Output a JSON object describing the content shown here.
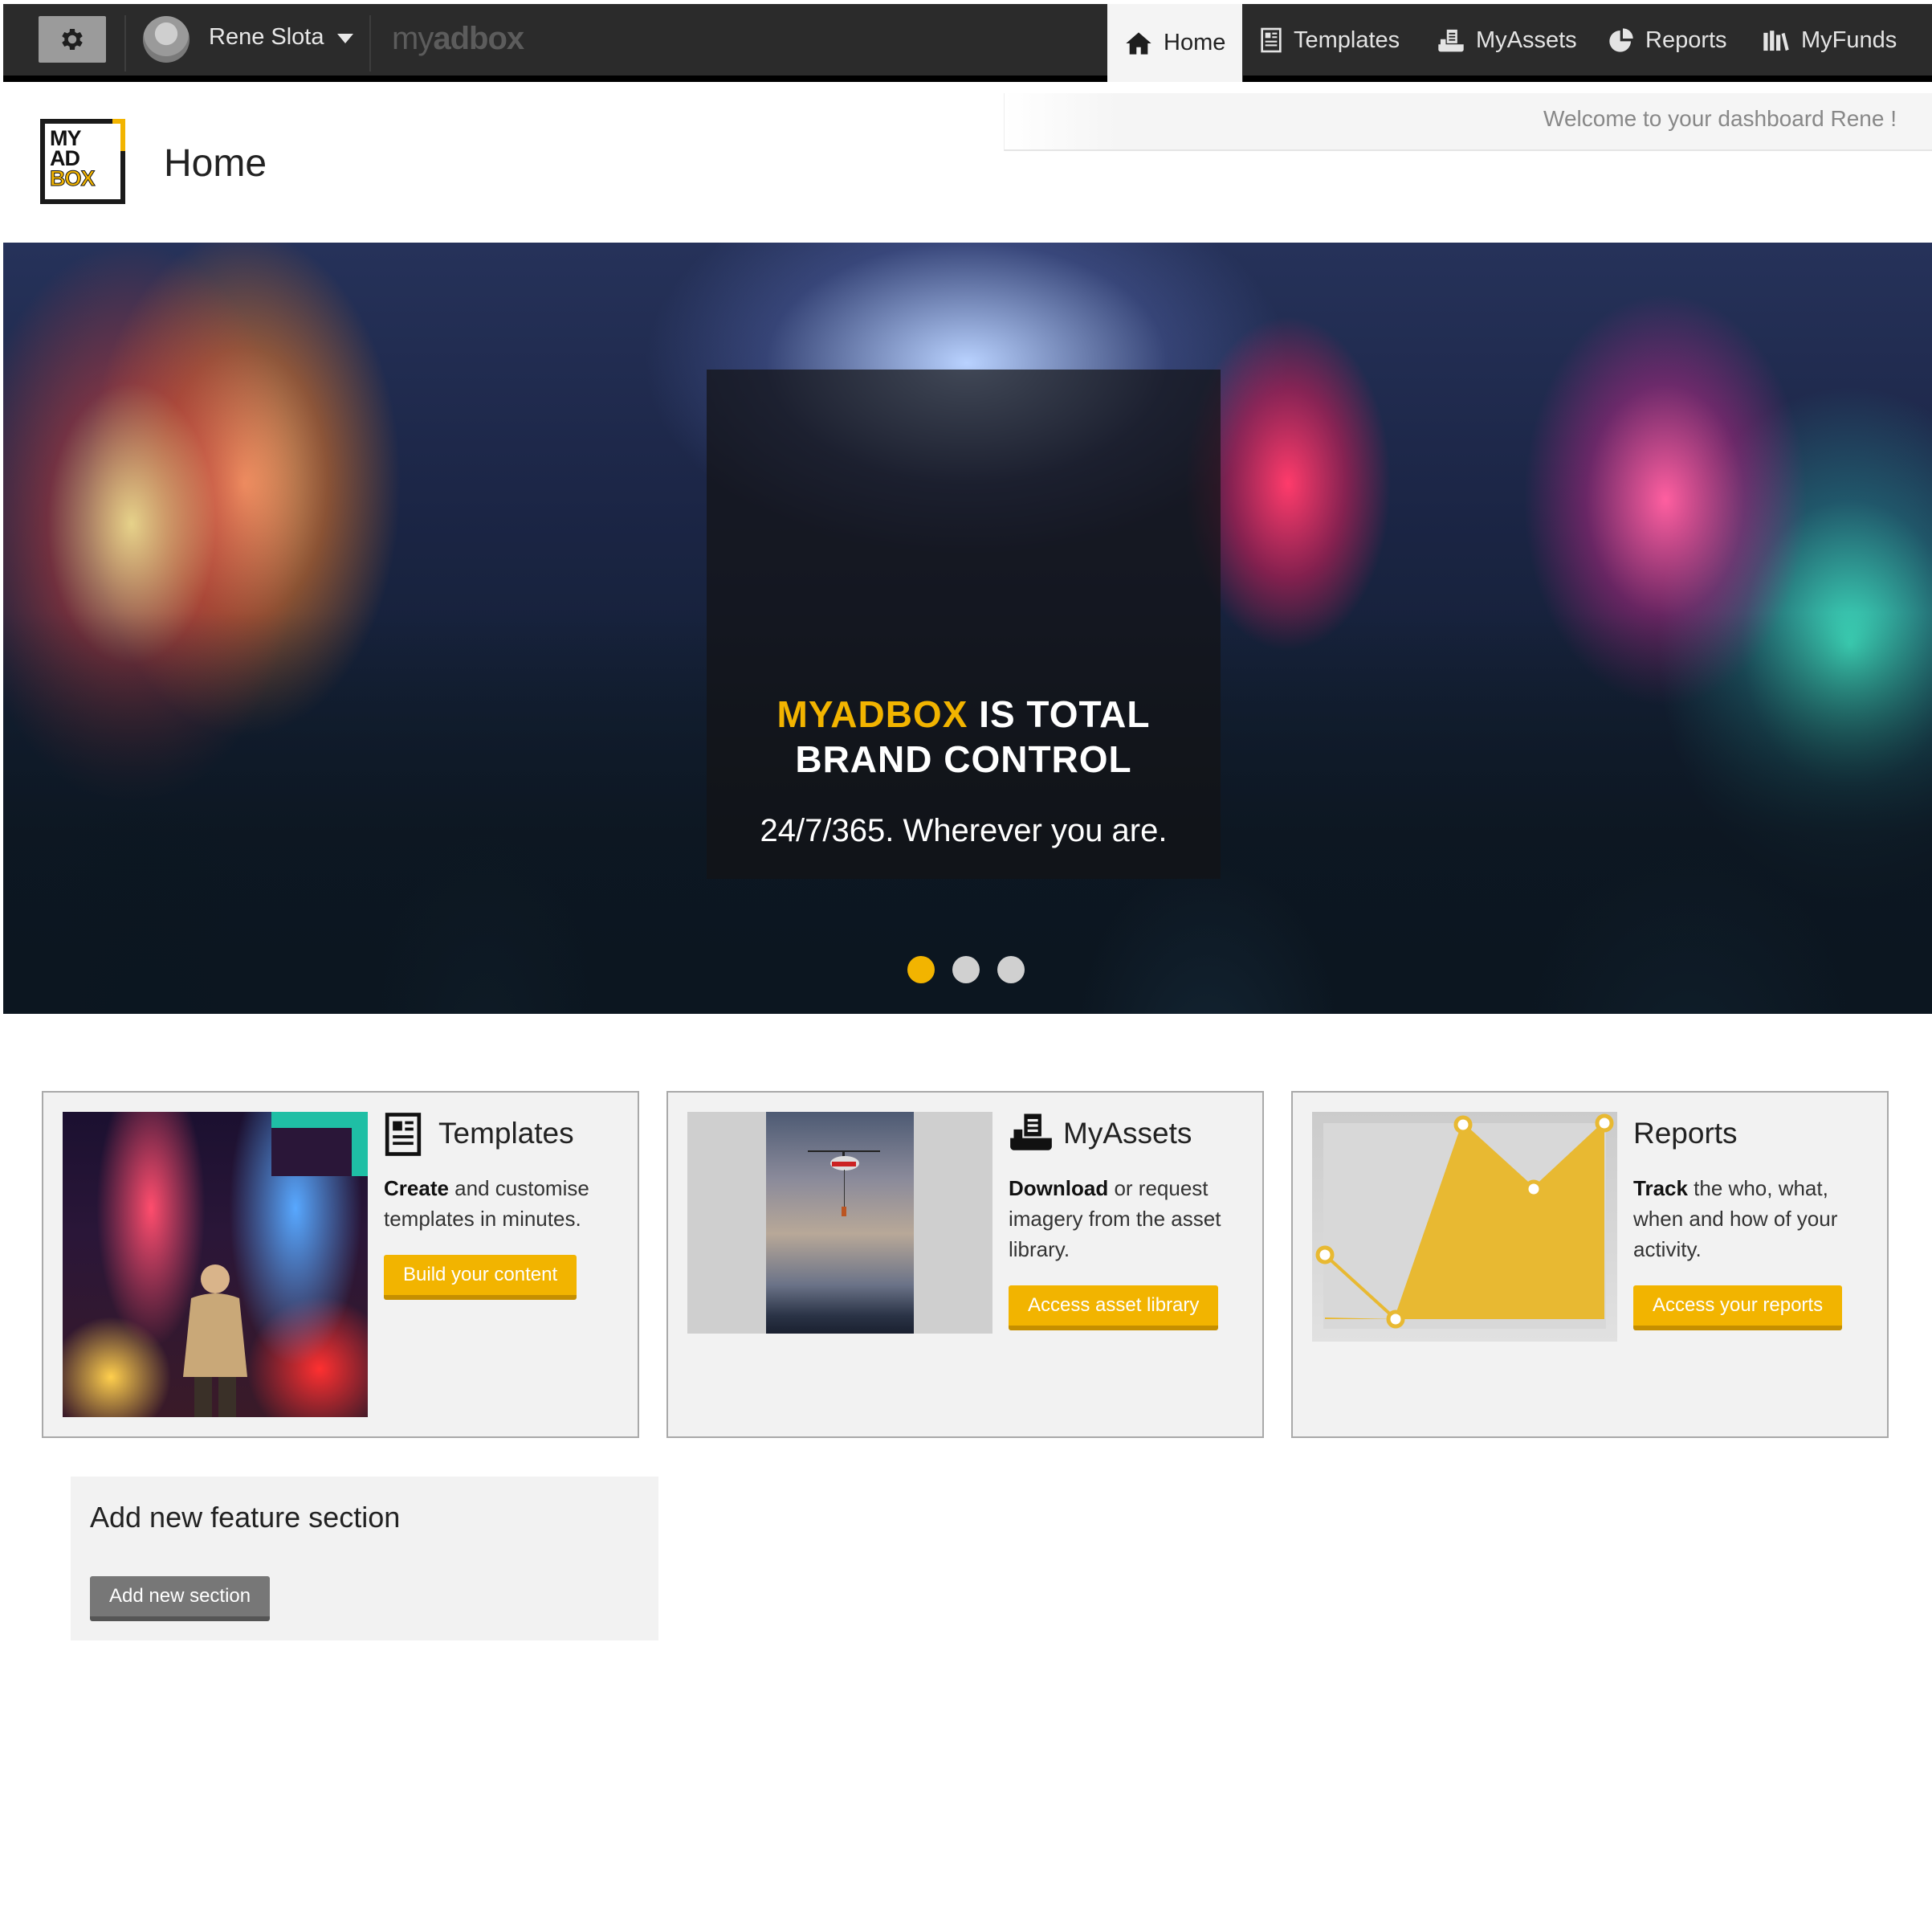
{
  "topbar": {
    "settings_icon": "gear-icon",
    "user_name": "Rene Slota",
    "brand_light": "my",
    "brand_bold": "adbox",
    "nav": [
      {
        "label": "Home",
        "icon": "home-icon",
        "active": true
      },
      {
        "label": "Templates",
        "icon": "templates-icon",
        "active": false
      },
      {
        "label": "MyAssets",
        "icon": "assets-icon",
        "active": false
      },
      {
        "label": "Reports",
        "icon": "reports-icon",
        "active": false
      },
      {
        "label": "MyFunds",
        "icon": "funds-icon",
        "active": false
      }
    ]
  },
  "header": {
    "welcome": "Welcome to your dashboard Rene !",
    "logo_lines": [
      "MY",
      "AD",
      "BOX"
    ],
    "title": "Home"
  },
  "hero": {
    "headline_brand": "MYADBOX",
    "headline_rest": " IS TOTAL",
    "headline_line2": "BRAND CONTROL",
    "subline": "24/7/365. Wherever you are.",
    "slides": 3,
    "active_slide": 1
  },
  "cards": [
    {
      "title": "Templates",
      "icon": "templates-icon",
      "text_bold": "Create",
      "text_rest": " and customise templates in minutes.",
      "button": "Build your content"
    },
    {
      "title": "MyAssets",
      "icon": "assets-icon",
      "text_bold": "Download",
      "text_rest": " or request imagery from the asset library.",
      "button": "Access asset library"
    },
    {
      "title": "Reports",
      "icon": "chart-icon",
      "text_bold": "Track",
      "text_rest": " the who, what, when and how of your activity.",
      "button": "Access your reports"
    }
  ],
  "add_section": {
    "title": "Add new feature section",
    "button": "Add new section"
  },
  "colors": {
    "accent": "#f2b400",
    "topbar": "#2b2b2b",
    "card_bg": "#f2f2f2"
  }
}
